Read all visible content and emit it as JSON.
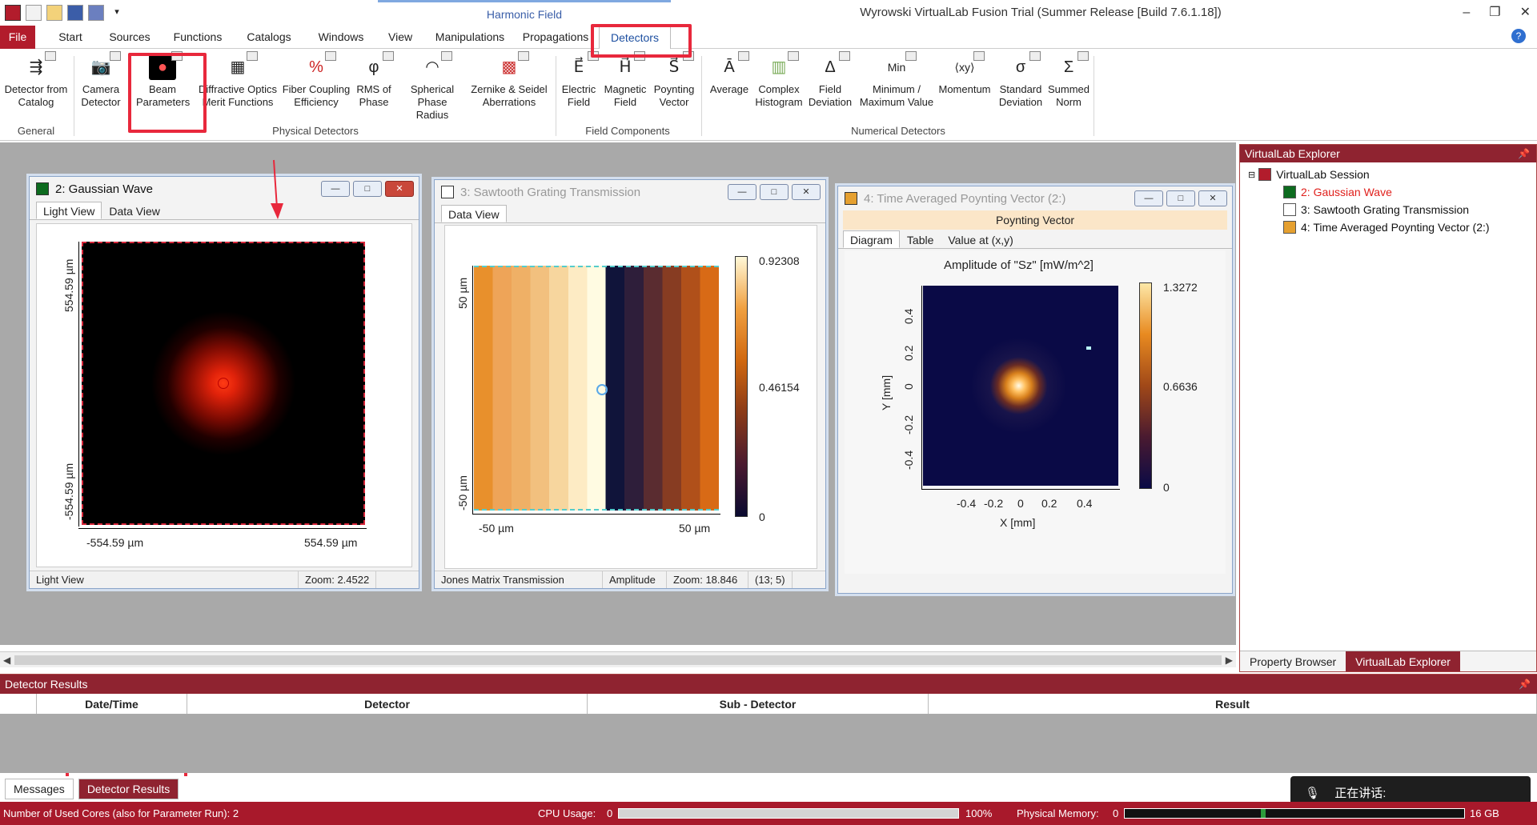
{
  "app": {
    "title": "Wyrowski VirtualLab Fusion Trial (Summer Release [Build 7.6.1.18])",
    "context_tab": "Harmonic Field"
  },
  "tabs": [
    "File",
    "Start",
    "Sources",
    "Functions",
    "Catalogs",
    "Windows",
    "View",
    "Manipulations",
    "Propagations",
    "Detectors"
  ],
  "ribbon": {
    "buttons": [
      {
        "label": "Detector from Catalog",
        "icon": "detector-catalog-icon"
      },
      {
        "label": "Camera Detector",
        "icon": "camera-icon"
      },
      {
        "label": "Beam Parameters",
        "icon": "beam-parameters-icon"
      },
      {
        "label": "Diffractive Optics Merit Functions",
        "icon": "merit-functions-icon"
      },
      {
        "label": "Fiber Coupling Efficiency",
        "icon": "fiber-coupling-icon"
      },
      {
        "label": "RMS of Phase",
        "icon": "rms-phase-icon"
      },
      {
        "label": "Spherical Phase Radius",
        "icon": "spherical-phase-icon"
      },
      {
        "label": "Zernike & Seidel Aberrations",
        "icon": "zernike-icon"
      },
      {
        "label": "Electric Field",
        "icon": "electric-field-icon"
      },
      {
        "label": "Magnetic Field",
        "icon": "magnetic-field-icon"
      },
      {
        "label": "Poynting Vector",
        "icon": "poynting-vector-icon"
      },
      {
        "label": "Average",
        "icon": "average-icon"
      },
      {
        "label": "Complex Histogram",
        "icon": "histogram-icon"
      },
      {
        "label": "Field Deviation",
        "icon": "field-deviation-icon"
      },
      {
        "label": "Minimum / Maximum Value",
        "icon": "min-max-icon"
      },
      {
        "label": "Momentum",
        "icon": "momentum-icon"
      },
      {
        "label": "Standard Deviation",
        "icon": "std-deviation-icon"
      },
      {
        "label": "Summed Norm",
        "icon": "summed-norm-icon"
      }
    ],
    "groups": [
      "General",
      "Physical Detectors",
      "Field Components",
      "Numerical Detectors"
    ]
  },
  "windows": {
    "w1": {
      "title": "2: Gaussian Wave",
      "tabs": [
        "Light View",
        "Data View"
      ],
      "yTop": "554.59 µm",
      "yBottom": "-554.59 µm",
      "xLeft": "-554.59 µm",
      "xRight": "554.59 µm",
      "status": [
        "Light View",
        "Zoom: 2.4522"
      ]
    },
    "w2": {
      "title": "3: Sawtooth Grating Transmission",
      "tabs": [
        "Data View"
      ],
      "yTop": "50 µm",
      "yBottom": "-50 µm",
      "xLeft": "-50 µm",
      "xRight": "50 µm",
      "cbar": [
        "0.92308",
        "0.46154",
        "0"
      ],
      "status": [
        "Jones Matrix Transmission",
        "Amplitude",
        "Zoom: 18.846",
        "(13; 5)"
      ]
    },
    "w3": {
      "title": "4: Time Averaged Poynting Vector (2:)",
      "header": "Poynting Vector",
      "tabs": [
        "Diagram",
        "Table",
        "Value at (x,y)"
      ],
      "plotTitle": "Amplitude of \"Sz\"  [mW/m^2]",
      "xlabel": "X [mm]",
      "ylabel": "Y [mm]",
      "xticks": [
        "-0.4",
        "-0.2",
        "0",
        "0.2",
        "0.4"
      ],
      "yticks": [
        "0.4",
        "0.2",
        "0",
        "-0.2",
        "-0.4"
      ],
      "cbar": [
        "1.3272",
        "0.6636",
        "0"
      ]
    }
  },
  "explorer": {
    "title": "VirtualLab Explorer",
    "items": [
      "VirtualLab Session",
      "2: Gaussian Wave",
      "3: Sawtooth Grating Transmission",
      "4: Time Averaged Poynting Vector (2:)"
    ],
    "tabs": [
      "Property Browser",
      "VirtualLab Explorer"
    ]
  },
  "results": {
    "title": "Detector Results",
    "columns": [
      "Date/Time",
      "Detector",
      "Sub - Detector",
      "Result"
    ],
    "tabs": [
      "Messages",
      "Detector Results"
    ]
  },
  "status": {
    "cores": "Number of Used Cores (also for Parameter Run): 2",
    "cpu_label": "CPU Usage:",
    "cpu_min": "0",
    "cpu_max": "100%",
    "mem_label": "Physical Memory:",
    "mem_min": "0",
    "mem_max": "16 GB"
  },
  "speaking": "正在讲话:",
  "colors": {
    "brand": "#8f2330",
    "highlight": "#e8283c"
  }
}
